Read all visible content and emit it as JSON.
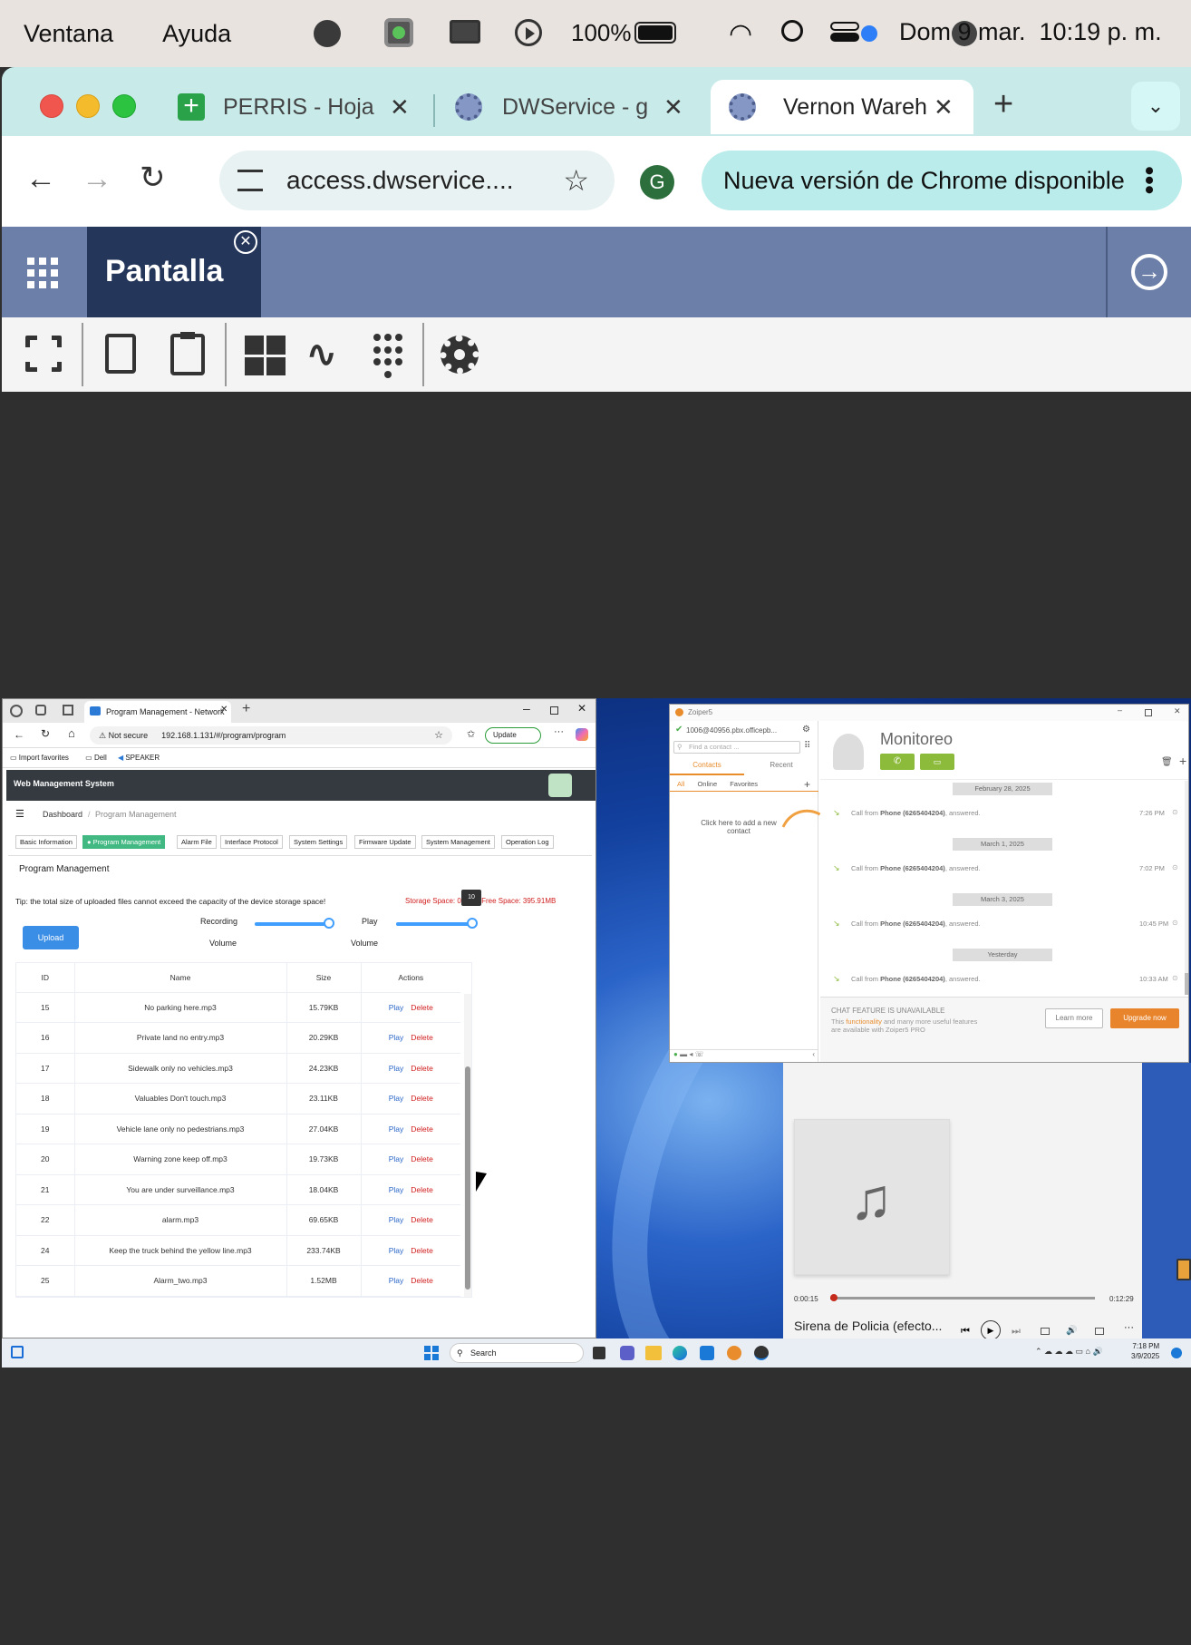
{
  "menubar": {
    "items": [
      "Ventana",
      "Ayuda"
    ],
    "battery": "100%",
    "datetime": "Dom 9 mar.  10:19 p. m."
  },
  "chrome": {
    "tabs": [
      {
        "title": "PERRIS - Hoja"
      },
      {
        "title": "DWService - g"
      },
      {
        "title": "Vernon Wareh"
      }
    ],
    "new_tab": "+",
    "url": "access.dwservice....",
    "profile_initial": "G",
    "update_label": "Nueva versión de Chrome disponible"
  },
  "dwservice": {
    "title": "Pantalla"
  },
  "edge": {
    "tab_title": "Program Management - Network",
    "security": "Not secure",
    "url": "192.168.1.131/#/program/program",
    "update_btn": "Update",
    "favorites": [
      "Import favorites",
      "Dell",
      "SPEAKER"
    ],
    "app_title": "Web Management System",
    "breadcrumb": [
      "Dashboard",
      "Program Management"
    ],
    "nav_tabs": [
      "Basic Information",
      "Program Management",
      "Alarm File",
      "Interface Protocol",
      "System Settings",
      "Firmware Update",
      "System Management",
      "Operation Log"
    ],
    "section_title": "Program Management",
    "tip": "Tip: the total size of uploaded files cannot exceed the capacity of the device storage space!",
    "storage": "Storage Space: ",
    "storage_value": "0MB",
    "free_space": "Free Space: 395.91MB",
    "upload_btn": "Upload",
    "recording_label": "Recording",
    "recording_volume_label": "Volume",
    "play_label": "Play",
    "play_volume_label": "Volume",
    "slider_tooltip": "10",
    "recording_level": 0.95,
    "play_level": 1.0,
    "columns": [
      "ID",
      "Name",
      "Size",
      "Actions"
    ],
    "action_play": "Play",
    "action_delete": "Delete",
    "rows": [
      {
        "id": "15",
        "name": "No parking here.mp3",
        "size": "15.79KB"
      },
      {
        "id": "16",
        "name": "Private land no entry.mp3",
        "size": "20.29KB"
      },
      {
        "id": "17",
        "name": "Sidewalk only no vehicles.mp3",
        "size": "24.23KB"
      },
      {
        "id": "18",
        "name": "Valuables Don't touch.mp3",
        "size": "23.11KB"
      },
      {
        "id": "19",
        "name": "Vehicle lane only no pedestrians.mp3",
        "size": "27.04KB"
      },
      {
        "id": "20",
        "name": "Warning zone keep off.mp3",
        "size": "19.73KB"
      },
      {
        "id": "21",
        "name": "You are under surveillance.mp3",
        "size": "18.04KB"
      },
      {
        "id": "22",
        "name": "alarm.mp3",
        "size": "69.65KB"
      },
      {
        "id": "24",
        "name": "Keep the truck behind the yellow line.mp3",
        "size": "233.74KB"
      },
      {
        "id": "25",
        "name": "Alarm_two.mp3",
        "size": "1.52MB"
      }
    ]
  },
  "zoiper": {
    "app_name": "Zoiper5",
    "account": "1006@40956.pbx.officepb...",
    "search_placeholder": "Find a contact ...",
    "tabs": [
      "Contacts",
      "Recent"
    ],
    "filters": [
      "All",
      "Online",
      "Favorites"
    ],
    "add_contact_hint": "Click here to add a new contact",
    "contact_name": "Monitoreo",
    "history": [
      {
        "date": "February 28, 2025",
        "text": "Call from ",
        "from": "Phone (6265404204)",
        "status": ", answered.",
        "time": "7:26 PM"
      },
      {
        "date": "March 1, 2025",
        "text": "Call from ",
        "from": "Phone (6265404204)",
        "status": ", answered.",
        "time": "7:02 PM"
      },
      {
        "date": "March 3, 2025",
        "text": "Call from ",
        "from": "Phone (6265404204)",
        "status": ", answered.",
        "time": "10:45 PM"
      },
      {
        "date": "Yesterday",
        "text": "Call from ",
        "from": "Phone (6265404204)",
        "status": ", answered.",
        "time": "10:33 AM"
      }
    ],
    "chat_unavailable": "CHAT FEATURE IS UNAVAILABLE",
    "chat_desc_1": "This ",
    "chat_desc_link": "functionality",
    "chat_desc_2": " and many more useful features",
    "chat_desc_3": "are available with Zoiper5 PRO",
    "learn_more": "Learn more",
    "upgrade_now": "Upgrade now"
  },
  "media": {
    "elapsed": "0:00:15",
    "total": "0:12:29",
    "progress": 0.02,
    "title": "Sirena de Policia (efecto..."
  },
  "taskbar": {
    "search": "Search",
    "time": "7:18 PM",
    "date": "3/9/2025"
  }
}
